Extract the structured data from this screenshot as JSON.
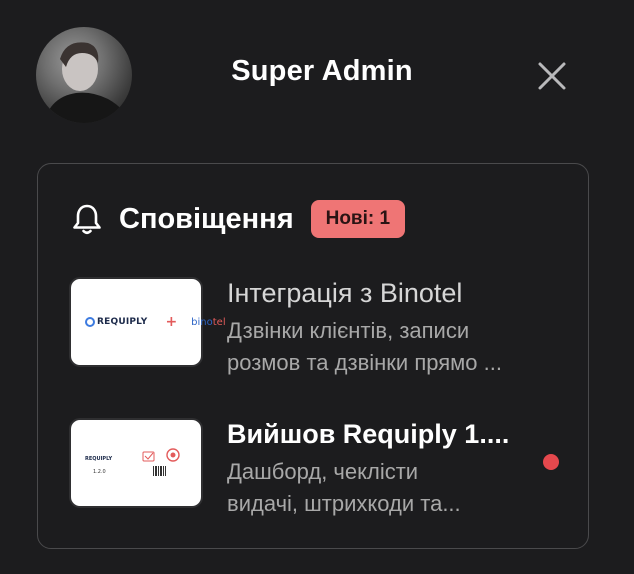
{
  "header": {
    "user_name": "Super Admin",
    "avatar_alt": "",
    "close_icon": "close-icon"
  },
  "notifications": {
    "title": "Сповіщення",
    "badge": "Нові: 1",
    "icon": "bell-icon",
    "items": [
      {
        "title": "Інтеграція з Binotel",
        "desc_line1": "Дзвінки клієнтів, записи",
        "desc_line2": "розмов та дзвінки прямо ...",
        "unread": false,
        "thumb": {
          "brand": "REQUIPLY",
          "plus": "+",
          "partner_a": "bino",
          "partner_b": "tel"
        }
      },
      {
        "title": "Вийшов Requiply 1....",
        "desc_line1": "Дашборд, чеклісти",
        "desc_line2": "видачі, штрихкоди та...",
        "unread": true,
        "thumb": {
          "brand": "REQUIPLY",
          "version": "1.2.0"
        }
      }
    ]
  },
  "colors": {
    "background": "#1c1c1e",
    "badge": "#ef7575",
    "unread_dot": "#e5484d",
    "panel_border": "#4a4a4c"
  }
}
